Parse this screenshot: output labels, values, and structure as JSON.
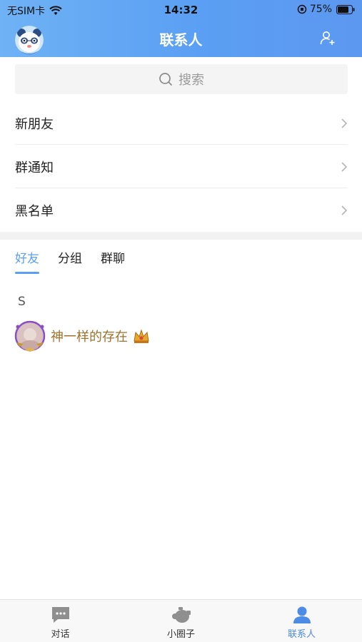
{
  "status_bar": {
    "carrier": "无SIM卡",
    "time": "14:32",
    "battery": "75%"
  },
  "header": {
    "title": "联系人"
  },
  "search": {
    "placeholder": "搜索"
  },
  "menu": [
    {
      "label": "新朋友"
    },
    {
      "label": "群通知"
    },
    {
      "label": "黑名单"
    }
  ],
  "tabs": [
    {
      "label": "好友",
      "active": true
    },
    {
      "label": "分组",
      "active": false
    },
    {
      "label": "群聊",
      "active": false
    }
  ],
  "contacts": {
    "section": "S",
    "items": [
      {
        "name": "神一样的存在"
      }
    ]
  },
  "tabbar": [
    {
      "label": "对话",
      "icon": "chat-icon"
    },
    {
      "label": "小圈子",
      "icon": "circle-icon"
    },
    {
      "label": "联系人",
      "icon": "contacts-icon",
      "active": true
    }
  ],
  "colors": {
    "accent": "#5a9ff3",
    "header_start": "#6fb2f5",
    "header_end": "#5d98f0",
    "contact_name": "#a0712c"
  }
}
